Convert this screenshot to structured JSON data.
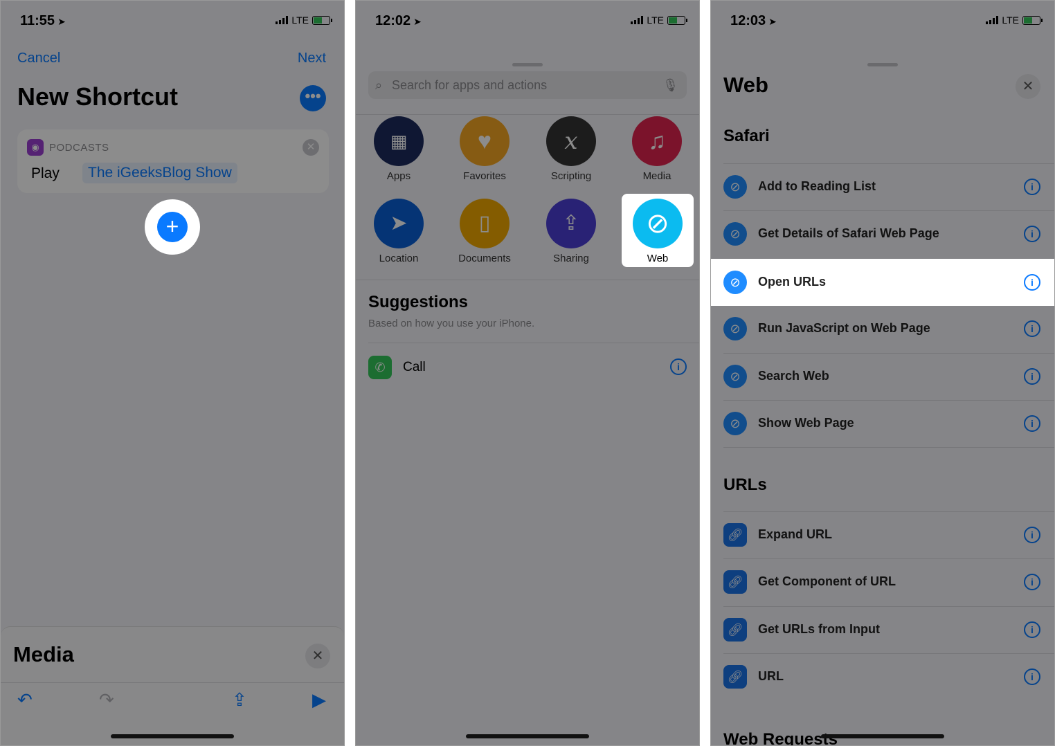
{
  "panel1": {
    "status": {
      "time": "11:55",
      "network": "LTE"
    },
    "nav": {
      "cancel": "Cancel",
      "next": "Next"
    },
    "title": "New Shortcut",
    "action": {
      "app": "PODCASTS",
      "verb": "Play",
      "token": "The iGeeksBlog Show"
    },
    "bottom_sheet": {
      "title": "Media"
    }
  },
  "panel2": {
    "status": {
      "time": "12:02",
      "network": "LTE"
    },
    "search": {
      "placeholder": "Search for apps and actions"
    },
    "categories": [
      "Apps",
      "Favorites",
      "Scripting",
      "Media",
      "Location",
      "Documents",
      "Sharing",
      "Web"
    ],
    "suggestions": {
      "title": "Suggestions",
      "subtitle": "Based on how you use your iPhone.",
      "items": [
        "Call"
      ]
    }
  },
  "panel3": {
    "status": {
      "time": "12:03",
      "network": "LTE"
    },
    "title": "Web",
    "sections": [
      {
        "title": "Safari",
        "items": [
          "Add to Reading List",
          "Get Details of Safari Web Page",
          "Open URLs",
          "Run JavaScript on Web Page",
          "Search Web",
          "Show Web Page"
        ]
      },
      {
        "title": "URLs",
        "items": [
          "Expand URL",
          "Get Component of URL",
          "Get URLs from Input",
          "URL"
        ]
      },
      {
        "title": "Web Requests"
      }
    ],
    "highlighted": "Open URLs"
  },
  "colors": {
    "accent": "#0a7aff",
    "web": "#0bbbf0",
    "call": "#34c759"
  }
}
